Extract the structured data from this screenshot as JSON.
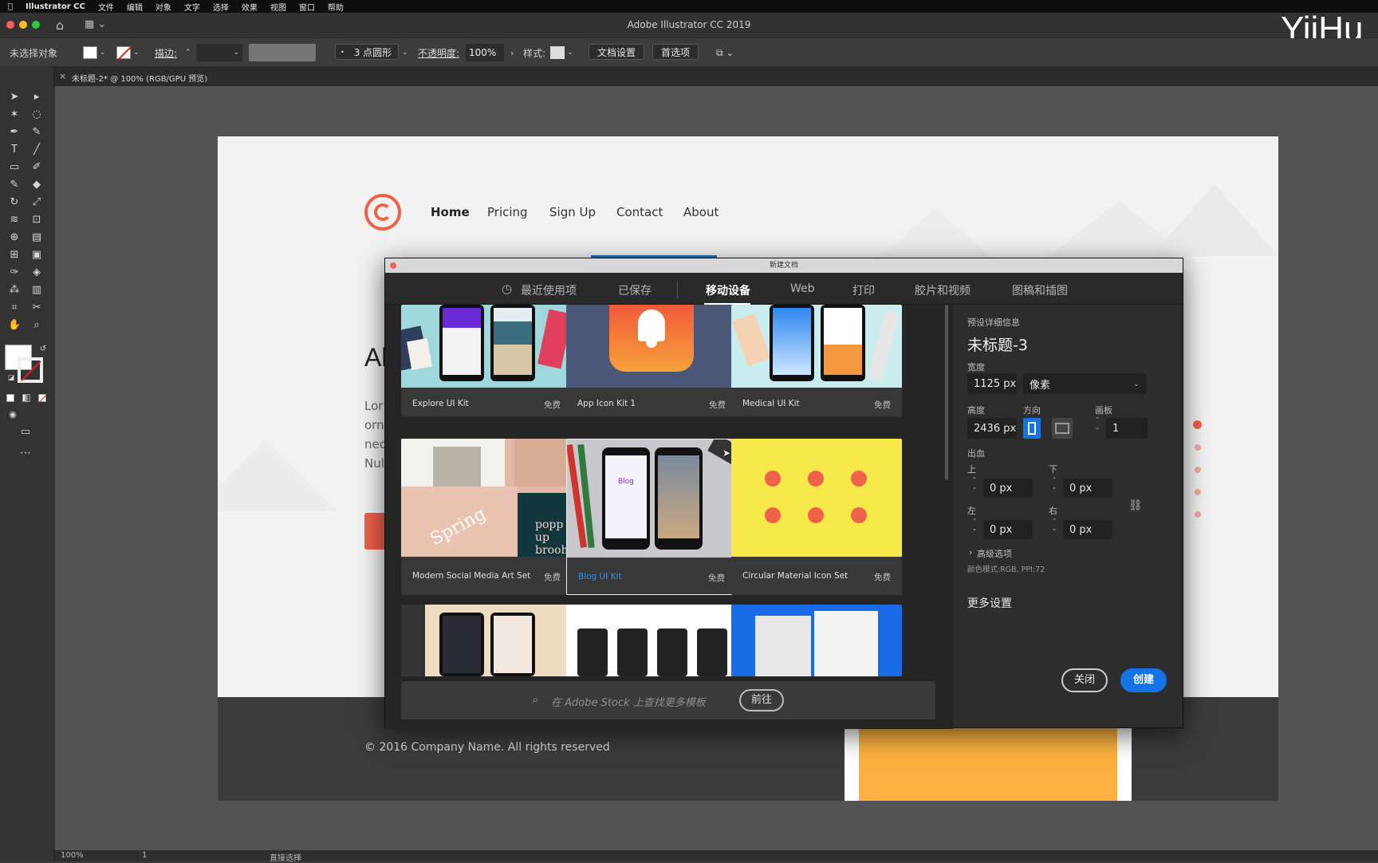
{
  "menubar": {
    "app_name": "Illustrator CC",
    "items": [
      "文件",
      "编辑",
      "对象",
      "文字",
      "选择",
      "效果",
      "视图",
      "窗口",
      "帮助"
    ]
  },
  "window": {
    "title": "Adobe Illustrator CC 2019",
    "watermark": "YiiHu"
  },
  "control_bar": {
    "selection": "未选择对象",
    "stroke_label": "描边:",
    "brush": "3 点圆形",
    "opacity_label": "不透明度:",
    "opacity_value": "100%",
    "style_label": "样式:",
    "doc_setup": "文档设置",
    "preferences": "首选项"
  },
  "doc_tab": {
    "label": "未标题-2* @ 100% (RGB/GPU 预览)",
    "close": "×"
  },
  "artboard": {
    "nav": [
      "Home",
      "Pricing",
      "Sign Up",
      "Contact",
      "About"
    ],
    "hero_fragment": "Al",
    "body_fragments": [
      "Lor",
      "orn",
      "nec",
      "Nul"
    ],
    "footer": "© 2016 Company Name. All rights reserved"
  },
  "status_bar": {
    "zoom": "100%",
    "artboard_num": "1",
    "tool": "直接选择"
  },
  "dialog": {
    "title": "新建文档",
    "tabs": [
      "最近使用项",
      "已保存",
      "移动设备",
      "Web",
      "打印",
      "胶片和视频",
      "图稿和插图"
    ],
    "active_tab": "移动设备",
    "templates": [
      {
        "name": "Explore UI Kit",
        "price": "免费"
      },
      {
        "name": "App Icon Kit 1",
        "price": "免费"
      },
      {
        "name": "Medical UI Kit",
        "price": "免费"
      },
      {
        "name": "Modern Social Media Art Set",
        "price": "免费"
      },
      {
        "name": "Blog UI Kit",
        "price": "免费"
      },
      {
        "name": "Circular Material Icon Set",
        "price": "免费"
      }
    ],
    "thumb_text": {
      "spring": "Spring",
      "popup": "popp up brooh",
      "blog": "Blog"
    },
    "search_placeholder": "在 Adobe Stock 上查找更多模板",
    "search_go": "前往",
    "preset": {
      "section": "预设详细信息",
      "name": "未标题-3",
      "width_label": "宽度",
      "width": "1125 px",
      "unit": "像素",
      "height_label": "高度",
      "height": "2436 px",
      "orientation_label": "方向",
      "artboards_label": "画板",
      "artboards": "1",
      "bleed_label": "出血",
      "top_label": "上",
      "bottom_label": "下",
      "left_label": "左",
      "right_label": "右",
      "top": "0 px",
      "bottom": "0 px",
      "left": "0 px",
      "right": "0 px",
      "advanced": "高级选项",
      "color_mode": "颜色模式:RGB, PPI:72",
      "more": "更多设置"
    },
    "close_btn": "关闭",
    "create_btn": "创建"
  },
  "colors": {
    "accent": "#1473e6",
    "brand_red": "#f0604a",
    "yellow": "#f8e94a",
    "orange": "#fbb040"
  }
}
